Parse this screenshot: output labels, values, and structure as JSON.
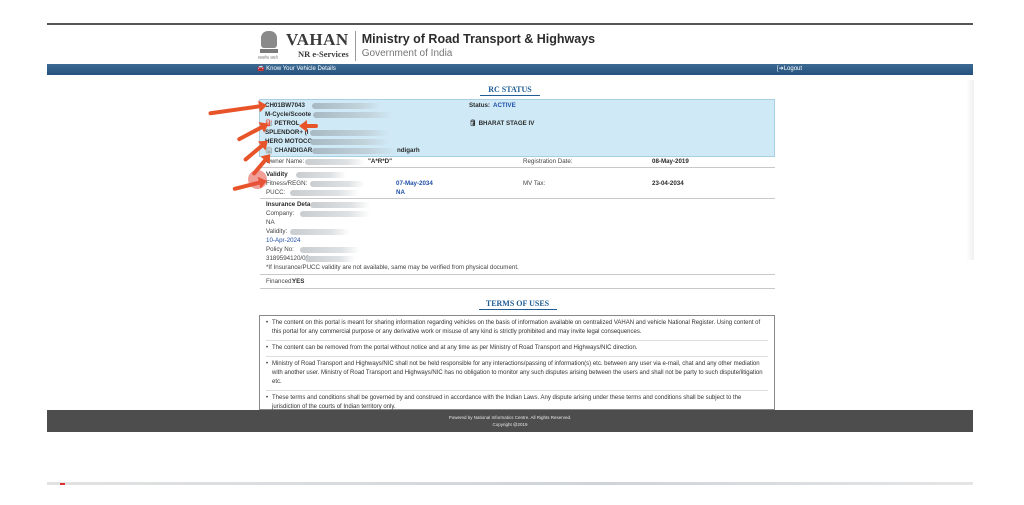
{
  "header": {
    "emblem_motto": "सत्यमेव जयते",
    "brand_title": "VAHAN",
    "brand_subtitle": "NR e-Services",
    "ministry_title": "Ministry of Road Transport & Highways",
    "ministry_subtitle": "Government of India"
  },
  "nav": {
    "left_icon": "car-icon",
    "left_label": "🚘 Know Your Vehicle Details",
    "right_icon": "logout-icon",
    "right_label": "[➜Logout"
  },
  "rc_status": {
    "title": "RC STATUS",
    "reg_no": "CH01BW7043",
    "vehicle_class": "M-Cycle/Scoote",
    "fuel_label": "⛽ PETROL",
    "model": "SPLENDOR+ (I",
    "maker": "HERO MOTOCO",
    "rto_start": "🏢 CHANDIGAR",
    "rto_end": "ndigarh",
    "status_label": "Status:",
    "status_value": "ACTIVE",
    "emission": "🛢 BHARAT STAGE IV"
  },
  "owner": {
    "label": "Owner Name:",
    "value": "\"A*R*D\"",
    "reg_date_label": "Registration Date:",
    "reg_date_value": "08-May-2019"
  },
  "validity": {
    "heading": "Validity",
    "fitness_label": "Fitness/REGN:",
    "fitness_value": "07-May-2034",
    "mv_tax_label": "MV Tax:",
    "mv_tax_value": "23-04-2034",
    "pucc_label": "PUCC:",
    "pucc_value": "NA"
  },
  "insurance": {
    "heading": "Insurance Deta",
    "company_label": "Company:",
    "company_value": "NA",
    "validity_label": "Validity:",
    "validity_value": "10-Apr-2024",
    "policy_label": "Policy No:",
    "policy_value": "3189594120/00",
    "note": "*If Insurance/PUCC validity are not available, same may be verified from physical document."
  },
  "financed": {
    "label": "Financed:",
    "value": "YES"
  },
  "terms": {
    "title": "TERMS OF USES",
    "items": [
      "The content on this portal is meant for sharing information regarding vehicles on the basis of information available on centralized VAHAN and vehicle National Register. Using content of this portal for any commercial purpose or any derivative work or misuse of any kind is strictly prohibited and may invite legal consequences.",
      "The content can be removed from the portal without notice and at any time as per Ministry of Road Transport and Highways/NIC direction.",
      "Ministry of Road Transport and Highways/NIC shall not be held responsible for any interactions/passing of information(s) etc. between any user via e-mail, chat and any other mediation with another user. Ministry of Road Transport and Highways/NIC has no obligation to monitor any such disputes arising between the users and shall not be party to such dispute/litigation etc.",
      "These terms and conditions shall be governed by and construed in accordance with the Indian Laws. Any dispute arising under these terms and conditions shall be subject to the jurisdiction of the courts of Indian territory only."
    ]
  },
  "footer": {
    "line1": "Powered by National Informatics Centre. All Rights Reserved.",
    "line2": "Copyright @2019"
  },
  "colors": {
    "accent_blue": "#1f5d94",
    "nav_bar": "#2f5f8a",
    "rc_panel": "#cfeaf6",
    "annotation_arrow": "#e8542a",
    "footer_bg": "#4d4d4d"
  }
}
